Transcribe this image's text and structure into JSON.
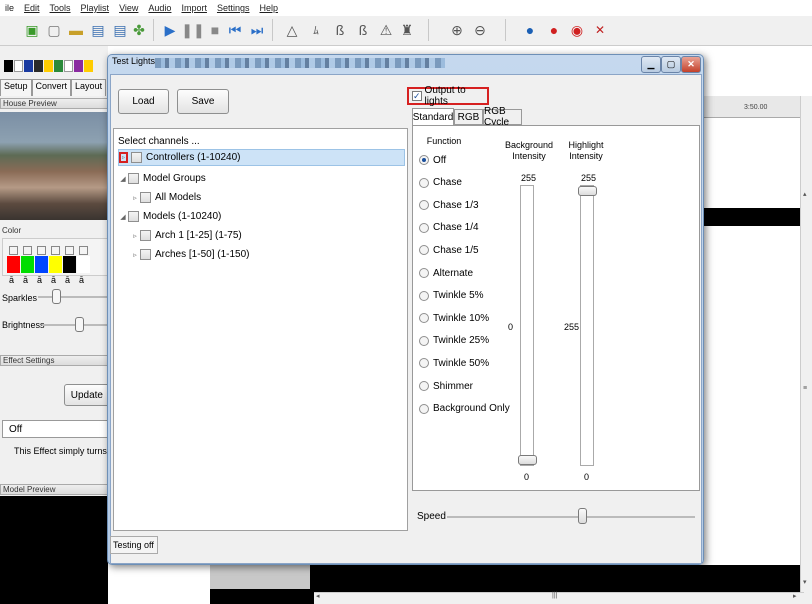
{
  "menu": [
    "ile",
    "Edit",
    "Tools",
    "Playlist",
    "View",
    "Audio",
    "Import",
    "Settings",
    "Help"
  ],
  "left": {
    "tabs": [
      "Setup",
      "Convert",
      "Layout"
    ],
    "house_preview": "House Preview",
    "color": "Color",
    "sparkles": "Sparkles",
    "brightness": "Brightness",
    "effect_settings": "Effect Settings",
    "update": "Update",
    "effect_value": "Off",
    "effect_desc": "This Effect simply turns eve",
    "model_preview": "Model Preview",
    "swatches": [
      "#ff0000",
      "#00dd00",
      "#0044ff",
      "#ffff00",
      "#000000",
      "#ffffff"
    ],
    "lock_glyph": "ā"
  },
  "right": {
    "timestamp": "3:50.00"
  },
  "dialog": {
    "title": "Test Lights",
    "load": "Load",
    "save": "Save",
    "select_channels": "Select channels ...",
    "tree": [
      {
        "label": "Controllers (1-10240)",
        "arrow": "▹",
        "selected": true
      },
      {
        "label": "Model Groups",
        "arrow": "◢"
      },
      {
        "label": "All Models",
        "arrow": "▹"
      },
      {
        "label": "Models (1-10240)",
        "arrow": "◢"
      },
      {
        "label": "Arch 1 [1-25] (1-75)",
        "arrow": "▹"
      },
      {
        "label": "Arches [1-50] (1-150)",
        "arrow": "▹"
      }
    ],
    "output_to_lights": "Output to lights",
    "tabs": [
      "Standard",
      "RGB",
      "RGB Cycle"
    ],
    "function_header": "Function",
    "bg_header": "Background Intensity",
    "hl_header": "Highlight Intensity",
    "functions": [
      "Off",
      "Chase",
      "Chase 1/3",
      "Chase 1/4",
      "Chase 1/5",
      "Alternate",
      "Twinkle 5%",
      "Twinkle 10%",
      "Twinkle 25%",
      "Twinkle 50%",
      "Shimmer",
      "Background Only"
    ],
    "bg_max": "255",
    "hl_max": "255",
    "bg_value": "0",
    "hl_value": "255",
    "bg_min": "0",
    "hl_min": "0",
    "bg_level": 0.0,
    "hl_level": 1.0,
    "speed": "Speed",
    "speed_level": 0.55,
    "status": "Testing off"
  }
}
